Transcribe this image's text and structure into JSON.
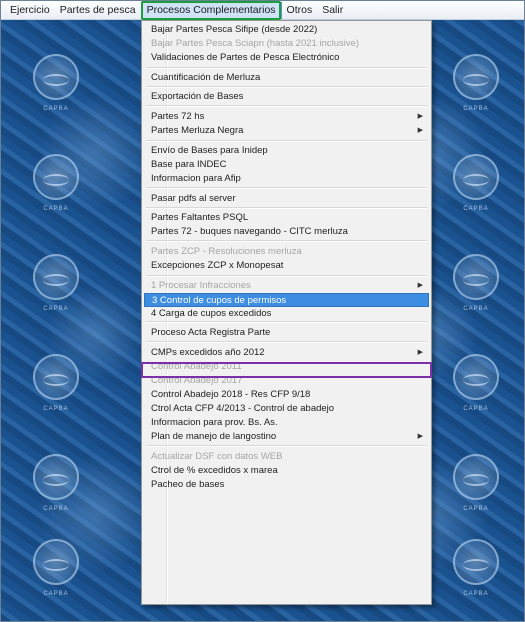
{
  "menubar": {
    "items": [
      "Ejercicio",
      "Partes de pesca",
      "Procesos Complementarios",
      "Otros",
      "Salir"
    ],
    "active_index": 2
  },
  "desktop": {
    "tile_label": "CAPBA"
  },
  "dropdown": {
    "items": [
      {
        "label": "Bajar Partes Pesca Sifipe (desde 2022)",
        "disabled": false
      },
      {
        "label": "Bajar Partes Pesca Sciapn (hasta 2021 inclusive)",
        "disabled": true
      },
      {
        "label": "Validaciones de Partes de Pesca Electrónico",
        "disabled": false
      },
      {
        "label": "Cuantificación de Merluza",
        "disabled": false
      },
      {
        "label": "Exportación de Bases",
        "disabled": false
      },
      {
        "label": "Partes 72 hs",
        "disabled": false,
        "submenu": true
      },
      {
        "label": "Partes Merluza Negra",
        "disabled": false,
        "submenu": true
      },
      {
        "label": "Envío de Bases para Inidep",
        "disabled": false
      },
      {
        "label": "Base para INDEC",
        "disabled": false
      },
      {
        "label": "Informacion para Afip",
        "disabled": false
      },
      {
        "label": "Pasar pdfs al server",
        "disabled": false
      },
      {
        "label": "Partes Faltantes PSQL",
        "disabled": false
      },
      {
        "label": "Partes 72 - buques navegando - CITC merluza",
        "disabled": false
      },
      {
        "label": "Partes ZCP - Resoluciones merluza",
        "disabled": true
      },
      {
        "label": "Excepciones ZCP x Monopesat",
        "disabled": false
      },
      {
        "label": "1 Procesar Infracciones",
        "disabled": true,
        "submenu": true
      },
      {
        "label": "3 Control de cupos de permisos",
        "disabled": false,
        "selected": true
      },
      {
        "label": "4 Carga de cupos excedidos",
        "disabled": false
      },
      {
        "label": "Proceso Acta Registra Parte",
        "disabled": false
      },
      {
        "label": "CMPs excedidos año 2012",
        "disabled": false,
        "submenu": true
      },
      {
        "label": "Control Abadejo 2011",
        "disabled": true
      },
      {
        "label": "Control Abadejo 2017",
        "disabled": true
      },
      {
        "label": "Control Abadejo 2018 - Res CFP 9/18",
        "disabled": false
      },
      {
        "label": "Ctrol Acta CFP 4/2013 - Control de abadejo",
        "disabled": false
      },
      {
        "label": "Informacion para prov. Bs. As.",
        "disabled": false
      },
      {
        "label": "Plan de manejo de langostino",
        "disabled": false,
        "submenu": true
      },
      {
        "label": "Actualizar DSF con datos WEB",
        "disabled": true
      },
      {
        "label": "Ctrol de % excedidos x marea",
        "disabled": false
      },
      {
        "label": "Pacheo de bases",
        "disabled": false
      }
    ],
    "submenu_arrow": "▶"
  }
}
